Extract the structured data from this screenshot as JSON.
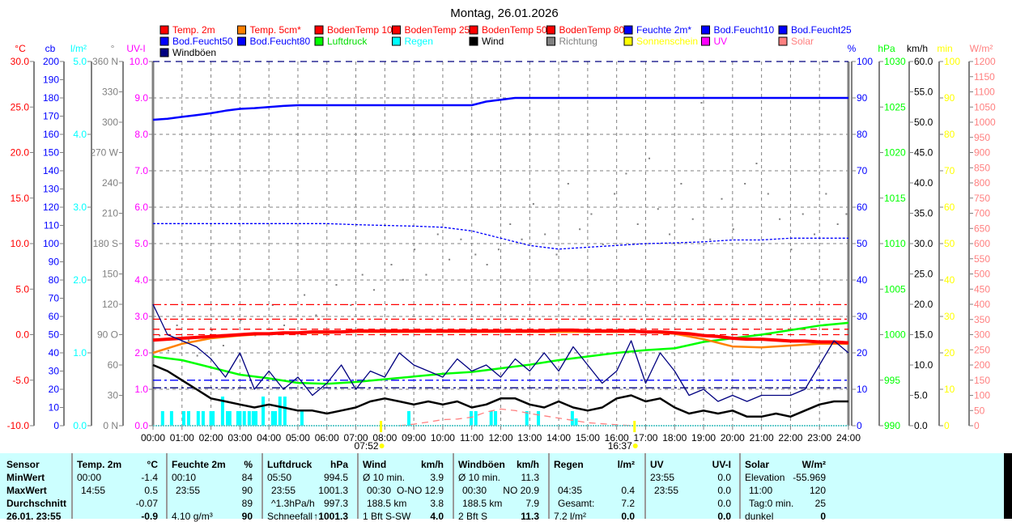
{
  "title": "Montag, 26.01.2026",
  "legend": [
    {
      "label": "Temp. 2m",
      "swatch": "#ff0000",
      "text": "#ff0000"
    },
    {
      "label": "Temp. 5cm*",
      "swatch": "#ff8000",
      "text": "#ff0000"
    },
    {
      "label": "BodenTemp 10",
      "swatch": "#ff0000",
      "text": "#ff0000"
    },
    {
      "label": "BodenTemp 25",
      "swatch": "#ff0000",
      "text": "#ff0000"
    },
    {
      "label": "BodenTemp 50",
      "swatch": "#ff0000",
      "text": "#ff0000"
    },
    {
      "label": "BodenTemp 80",
      "swatch": "#ff0000",
      "text": "#ff0000"
    },
    {
      "label": "Feuchte 2m*",
      "swatch": "#0000ff",
      "text": "#0000ff"
    },
    {
      "label": "Bod.Feucht10",
      "swatch": "#0000ff",
      "text": "#0000ff"
    },
    {
      "label": "Bod.Feucht25",
      "swatch": "#0000ff",
      "text": "#0000ff"
    },
    {
      "label": "Bod.Feucht50",
      "swatch": "#0000ff",
      "text": "#0000ff"
    },
    {
      "label": "Bod.Feucht80",
      "swatch": "#0000ff",
      "text": "#0000ff"
    },
    {
      "label": "Luftdruck",
      "swatch": "#00ff00",
      "text": "#00dd00"
    },
    {
      "label": "Regen",
      "swatch": "#00ffff",
      "text": "#00ffff"
    },
    {
      "label": "Wind",
      "swatch": "#000000",
      "text": "#000000"
    },
    {
      "label": "Richtung",
      "swatch": "#808080",
      "text": "#808080"
    },
    {
      "label": "Sonnenschein",
      "swatch": "#ffff00",
      "text": "#ffff00"
    },
    {
      "label": "UV",
      "swatch": "#ff00ff",
      "text": "#ff00ff"
    },
    {
      "label": "Solar",
      "swatch": "#ff8080",
      "text": "#ff8080"
    },
    {
      "label": "Windböen",
      "swatch": "#000080",
      "text": "#000000"
    }
  ],
  "chart_data": {
    "type": "line",
    "title": "Montag, 26.01.2026",
    "x_range_hours": [
      0,
      24
    ],
    "x_ticks": [
      "00:00",
      "01:00",
      "02:00",
      "03:00",
      "04:00",
      "05:00",
      "06:00",
      "07:00",
      "08:00",
      "09:00",
      "10:00",
      "11:00",
      "12:00",
      "13:00",
      "14:00",
      "15:00",
      "16:00",
      "17:00",
      "18:00",
      "19:00",
      "20:00",
      "21:00",
      "22:00",
      "23:00",
      "24:00"
    ],
    "grid": true,
    "legend_position": "top",
    "axes": [
      {
        "id": "temp",
        "unit": "°C",
        "side": "left",
        "color": "#ff0000",
        "min": -10,
        "max": 30,
        "step": 5,
        "decimals": 1
      },
      {
        "id": "cb",
        "unit": "cb",
        "side": "left",
        "color": "#0000ff",
        "min": 0,
        "max": 200,
        "step": 10,
        "decimals": 0
      },
      {
        "id": "rain",
        "unit": "l/m²",
        "side": "left",
        "color": "#00ffff",
        "min": 0,
        "max": 5,
        "step": 1,
        "decimals": 1
      },
      {
        "id": "dir",
        "unit": "°",
        "side": "left",
        "color": "#808080",
        "min": 0,
        "max": 360,
        "step": 30,
        "decimals": 0,
        "labels": [
          "0 N",
          "30",
          "60",
          "90 O",
          "120",
          "150",
          "180 S",
          "210",
          "240",
          "270 W",
          "300",
          "330",
          "360 N"
        ]
      },
      {
        "id": "uvi",
        "unit": "UV-I",
        "side": "left",
        "color": "#ff00ff",
        "min": 0,
        "max": 10,
        "step": 1,
        "decimals": 1
      },
      {
        "id": "hum",
        "unit": "%",
        "side": "right",
        "color": "#0000ff",
        "min": 0,
        "max": 100,
        "step": 10,
        "decimals": 0
      },
      {
        "id": "hpa",
        "unit": "hPa",
        "side": "right",
        "color": "#00ff00",
        "min": 990,
        "max": 1030,
        "step": 5,
        "decimals": 0
      },
      {
        "id": "kmh",
        "unit": "km/h",
        "side": "right",
        "color": "#000000",
        "min": 0,
        "max": 60,
        "step": 5,
        "decimals": 1
      },
      {
        "id": "min",
        "unit": "min",
        "side": "right",
        "color": "#ffff00",
        "min": 0,
        "max": 100,
        "step": 10,
        "decimals": 0
      },
      {
        "id": "wm2",
        "unit": "W/m²",
        "side": "right",
        "color": "#ff8080",
        "min": 0,
        "max": 1200,
        "step": 50,
        "decimals": 0
      }
    ],
    "series": [
      {
        "name": "BodenTemp 10",
        "axis": "temp",
        "color": "#ff0000",
        "style": "dashdot",
        "constant": 3.3
      },
      {
        "name": "BodenTemp 25",
        "axis": "temp",
        "color": "#ff0000",
        "style": "dashdot",
        "constant": 1.7
      },
      {
        "name": "BodenTemp 50",
        "axis": "temp",
        "color": "#ff0000",
        "style": "dashed",
        "constant": 0.6
      },
      {
        "name": "BodenTemp 80",
        "axis": "temp",
        "color": "#ff0000",
        "style": "dashed",
        "constant": 0.0
      },
      {
        "name": "Bod.Feucht10",
        "axis": "hum",
        "color": "#0000ff",
        "style": "dashdot",
        "constant": 12.5
      },
      {
        "name": "Bod.Feucht25",
        "axis": "hum",
        "color": "#000080",
        "style": "dashdot",
        "constant": 10.4
      },
      {
        "name": "Bod.Feucht80",
        "axis": "hum",
        "color": "#000080",
        "style": "dashed",
        "constant": 100
      },
      {
        "name": "Bod.Feucht50",
        "axis": "hum",
        "color": "#0000ff",
        "style": "dotted",
        "step": 1,
        "values": [
          55.5,
          55.5,
          55.5,
          55.5,
          55.5,
          55.5,
          55.5,
          55.2,
          55,
          54.8,
          54.5,
          53.5,
          51.5,
          49.5,
          48.5,
          49,
          49.5,
          50,
          50.2,
          50.5,
          51,
          51,
          51.5,
          51.5,
          51.5
        ]
      },
      {
        "name": "Solar",
        "axis": "wm2",
        "color": "#ff8080",
        "style": "dashed",
        "points": [
          [
            8.5,
            0
          ],
          [
            9,
            5
          ],
          [
            9.5,
            12
          ],
          [
            10,
            20
          ],
          [
            10.5,
            22
          ],
          [
            11,
            28
          ],
          [
            11.5,
            45
          ],
          [
            12,
            55
          ],
          [
            12.5,
            50
          ],
          [
            13,
            40
          ],
          [
            14,
            25
          ],
          [
            15,
            10
          ],
          [
            16,
            3
          ],
          [
            16.6,
            0
          ]
        ]
      },
      {
        "name": "Luftdruck",
        "axis": "hpa",
        "color": "#00ff00",
        "style": "solid",
        "width": 2.5,
        "step": 1,
        "values": [
          997.6,
          997.2,
          996.4,
          995.6,
          995.2,
          994.7,
          994.6,
          994.8,
          995.1,
          995.4,
          995.7,
          995.9,
          996.3,
          996.7,
          997.2,
          997.6,
          998.0,
          998.3,
          998.5,
          999.2,
          999.6,
          1000.0,
          1000.5,
          1001.0,
          1001.3
        ]
      },
      {
        "name": "Temp. 5cm*",
        "axis": "temp",
        "color": "#ff8000",
        "style": "solid",
        "width": 2.5,
        "step": 1,
        "values": [
          -2.0,
          -1.0,
          -0.4,
          -0.1,
          0.1,
          0.2,
          0.2,
          0.3,
          0.3,
          0.3,
          0.3,
          0.3,
          0.3,
          0.3,
          0.3,
          0.3,
          0.3,
          0.3,
          0.1,
          -0.5,
          -1.3,
          -1.4,
          -1.2,
          -1.0,
          -1.0
        ]
      },
      {
        "name": "Temp. 2m",
        "axis": "temp",
        "color": "#ff0000",
        "style": "solid",
        "width": 4,
        "step": 0.5,
        "values": [
          -0.6,
          -0.5,
          -0.4,
          -0.3,
          -0.2,
          -0.1,
          0,
          0.1,
          0.1,
          0.2,
          0.2,
          0.3,
          0.3,
          0.3,
          0.4,
          0.4,
          0.4,
          0.4,
          0.4,
          0.4,
          0.4,
          0.4,
          0.4,
          0.4,
          0.4,
          0.4,
          0.4,
          0.4,
          0.5,
          0.5,
          0.4,
          0.4,
          0.4,
          0.4,
          0.3,
          0.3,
          0.2,
          0.1,
          -0.1,
          -0.2,
          -0.4,
          -0.5,
          -0.5,
          -0.6,
          -0.7,
          -0.7,
          -0.8,
          -0.8,
          -0.9
        ]
      },
      {
        "name": "Feuchte 2m*",
        "axis": "hum",
        "color": "#0000ff",
        "style": "solid",
        "width": 2.5,
        "step": 0.5,
        "values": [
          84,
          84.3,
          84.8,
          85.3,
          85.8,
          86.5,
          87,
          87.2,
          87.5,
          87.8,
          88,
          88,
          88,
          88,
          88,
          88,
          88,
          88,
          88,
          88,
          88,
          88,
          88,
          89,
          89.5,
          90,
          90,
          90,
          90,
          90,
          90,
          90,
          90,
          90,
          90,
          90,
          90,
          90,
          90,
          90,
          90,
          90,
          90,
          90,
          90,
          90,
          90,
          90,
          90
        ]
      },
      {
        "name": "Windböen",
        "axis": "kmh",
        "color": "#000080",
        "style": "solid",
        "width": 1.3,
        "step": 0.5,
        "values": [
          20,
          15,
          14,
          13,
          11,
          8,
          12,
          6,
          9,
          6,
          8,
          5,
          7,
          10,
          6,
          9,
          8,
          12,
          10,
          9,
          8,
          11,
          9,
          10,
          8,
          11,
          9,
          12,
          9,
          13,
          10,
          7,
          9,
          14,
          7,
          12,
          9,
          5,
          6,
          4,
          5,
          4,
          5,
          5,
          5,
          6,
          10,
          14,
          12
        ]
      },
      {
        "name": "Wind",
        "axis": "kmh",
        "color": "#000000",
        "style": "solid",
        "width": 2.5,
        "step": 0.5,
        "values": [
          10,
          9,
          7.5,
          6,
          4.5,
          4,
          3.5,
          3,
          3.5,
          3,
          2.5,
          2.5,
          2,
          2.5,
          3,
          4,
          4.5,
          4,
          3.5,
          4,
          3.5,
          4,
          3,
          3.5,
          4.5,
          4.5,
          3.5,
          3,
          4,
          3,
          2.5,
          3,
          4.5,
          5,
          4,
          4.5,
          3,
          2,
          2.5,
          2,
          2.5,
          1.5,
          1.5,
          2,
          1.5,
          2.5,
          3.5,
          4,
          4
        ]
      }
    ],
    "regen_bars": {
      "axis": "rain",
      "color": "#00ffff",
      "points": [
        [
          0.33,
          0.2
        ],
        [
          0.64,
          0.2
        ],
        [
          1.06,
          0.2
        ],
        [
          1.23,
          0.2
        ],
        [
          1.56,
          0.2
        ],
        [
          1.73,
          0.2
        ],
        [
          2.0,
          0.2
        ],
        [
          2.07,
          0.2
        ],
        [
          2.4,
          0.4
        ],
        [
          2.57,
          0.2
        ],
        [
          2.65,
          0.2
        ],
        [
          2.93,
          0.2
        ],
        [
          3.0,
          0.2
        ],
        [
          3.15,
          0.2
        ],
        [
          3.32,
          0.2
        ],
        [
          3.46,
          0.2
        ],
        [
          3.55,
          0.2
        ],
        [
          3.8,
          0.4
        ],
        [
          4.13,
          0.2
        ],
        [
          4.22,
          0.2
        ],
        [
          4.38,
          0.4
        ],
        [
          4.55,
          0.4
        ],
        [
          5.14,
          0.2
        ],
        [
          8.83,
          0.2
        ],
        [
          10.98,
          0.2
        ],
        [
          11.14,
          0.2
        ],
        [
          11.67,
          0.2
        ],
        [
          11.82,
          0.2
        ],
        [
          12.9,
          0.2
        ],
        [
          13.3,
          0.2
        ],
        [
          14.47,
          0.2
        ],
        [
          14.6,
          0.1
        ]
      ]
    },
    "richtung_points": {
      "axis": "dir",
      "color": "#808080",
      "points": [
        [
          0.2,
          90
        ],
        [
          0.5,
          75
        ],
        [
          0.8,
          100
        ],
        [
          1.2,
          85
        ],
        [
          1.5,
          70
        ],
        [
          2.0,
          95
        ],
        [
          2.4,
          80
        ],
        [
          3.0,
          105
        ],
        [
          3.5,
          90
        ],
        [
          4.1,
          120
        ],
        [
          4.5,
          100
        ],
        [
          5.2,
          130
        ],
        [
          5.6,
          110
        ],
        [
          6.3,
          140
        ],
        [
          6.8,
          120
        ],
        [
          7.2,
          150
        ],
        [
          7.6,
          135
        ],
        [
          8.2,
          160
        ],
        [
          8.6,
          145
        ],
        [
          9.0,
          175
        ],
        [
          9.4,
          150
        ],
        [
          9.8,
          190
        ],
        [
          10.2,
          165
        ],
        [
          10.6,
          185
        ],
        [
          11.1,
          170
        ],
        [
          11.5,
          160
        ],
        [
          11.9,
          175
        ],
        [
          12.3,
          200
        ],
        [
          12.7,
          185
        ],
        [
          13.1,
          220
        ],
        [
          13.5,
          190
        ],
        [
          13.9,
          170
        ],
        [
          14.3,
          240
        ],
        [
          14.7,
          195
        ],
        [
          15.1,
          210
        ],
        [
          15.5,
          180
        ],
        [
          15.9,
          230
        ],
        [
          16.3,
          250
        ],
        [
          16.7,
          200
        ],
        [
          17.1,
          265
        ],
        [
          17.4,
          215
        ],
        [
          17.8,
          190
        ],
        [
          18.2,
          240
        ],
        [
          18.6,
          205
        ],
        [
          18.9,
          320
        ],
        [
          19.2,
          185
        ],
        [
          19.6,
          225
        ],
        [
          20.0,
          195
        ],
        [
          20.4,
          240
        ],
        [
          20.8,
          260
        ],
        [
          21.2,
          230
        ],
        [
          21.6,
          205
        ],
        [
          22.0,
          175
        ],
        [
          22.4,
          210
        ],
        [
          22.8,
          190
        ],
        [
          23.2,
          230
        ],
        [
          23.6,
          200
        ],
        [
          23.9,
          210
        ]
      ]
    },
    "sun": {
      "sunrise": "07:52",
      "sunset": "16:37",
      "sunrise_h": 7.867,
      "sunset_h": 16.617,
      "color": "#ffff00"
    }
  },
  "table": {
    "row_labels": [
      "Sensor",
      "MinWert",
      "MaxWert",
      "Durchschnitt",
      "26.01. 23:55"
    ],
    "groups": [
      {
        "header": "Temp. 2m",
        "unit": "°C",
        "rows": [
          [
            "00:00",
            "-1.4"
          ],
          [
            "14:55",
            "0.5"
          ],
          [
            "",
            "-0.07"
          ],
          [
            "",
            "-0.9"
          ]
        ]
      },
      {
        "header": "Feuchte 2m",
        "unit": "%",
        "rows": [
          [
            "00:10",
            "84"
          ],
          [
            "23:55",
            "90"
          ],
          [
            "",
            "89"
          ],
          [
            "4.10 g/m³",
            "90"
          ]
        ]
      },
      {
        "header": "Luftdruck",
        "unit": "hPa",
        "rows": [
          [
            "05:50",
            "994.5"
          ],
          [
            "23:55",
            "1001.3"
          ],
          [
            "^1.3hPa/h",
            "997.3"
          ],
          [
            "Schneefall",
            "↑1001.3"
          ]
        ]
      },
      {
        "header": "Wind",
        "unit": "km/h",
        "rows": [
          [
            "Ø 10 min.",
            "3.9"
          ],
          [
            "00:30",
            "O-NO 12.9"
          ],
          [
            "188.5 km",
            "3.8"
          ],
          [
            "1 Bft S-SW",
            "4.0"
          ]
        ]
      },
      {
        "header": "Windböen",
        "unit": "km/h",
        "rows": [
          [
            "Ø 10 min.",
            "11.3"
          ],
          [
            "00:30",
            "NO 20.9"
          ],
          [
            "188.5 km",
            "7.9"
          ],
          [
            "2 Bft S",
            "11.3"
          ]
        ]
      },
      {
        "header": "Regen",
        "unit": "l/m²",
        "rows": [
          [
            "",
            ""
          ],
          [
            "04:35",
            "0.4"
          ],
          [
            "Gesamt:",
            "7.2"
          ],
          [
            "7.2 l/m²",
            "0.0"
          ]
        ]
      },
      {
        "header": "UV",
        "unit": "UV-I",
        "rows": [
          [
            "23:55",
            "0.0"
          ],
          [
            "23:55",
            "0.0"
          ],
          [
            "",
            "0.0"
          ],
          [
            "",
            "0.0"
          ]
        ]
      },
      {
        "header": "Solar",
        "unit": "W/m²",
        "rows": [
          [
            "Elevation",
            "-55.969"
          ],
          [
            "11:00",
            "120"
          ],
          [
            "Tag:0 min.",
            "25"
          ],
          [
            "dunkel",
            "0"
          ]
        ]
      }
    ]
  }
}
